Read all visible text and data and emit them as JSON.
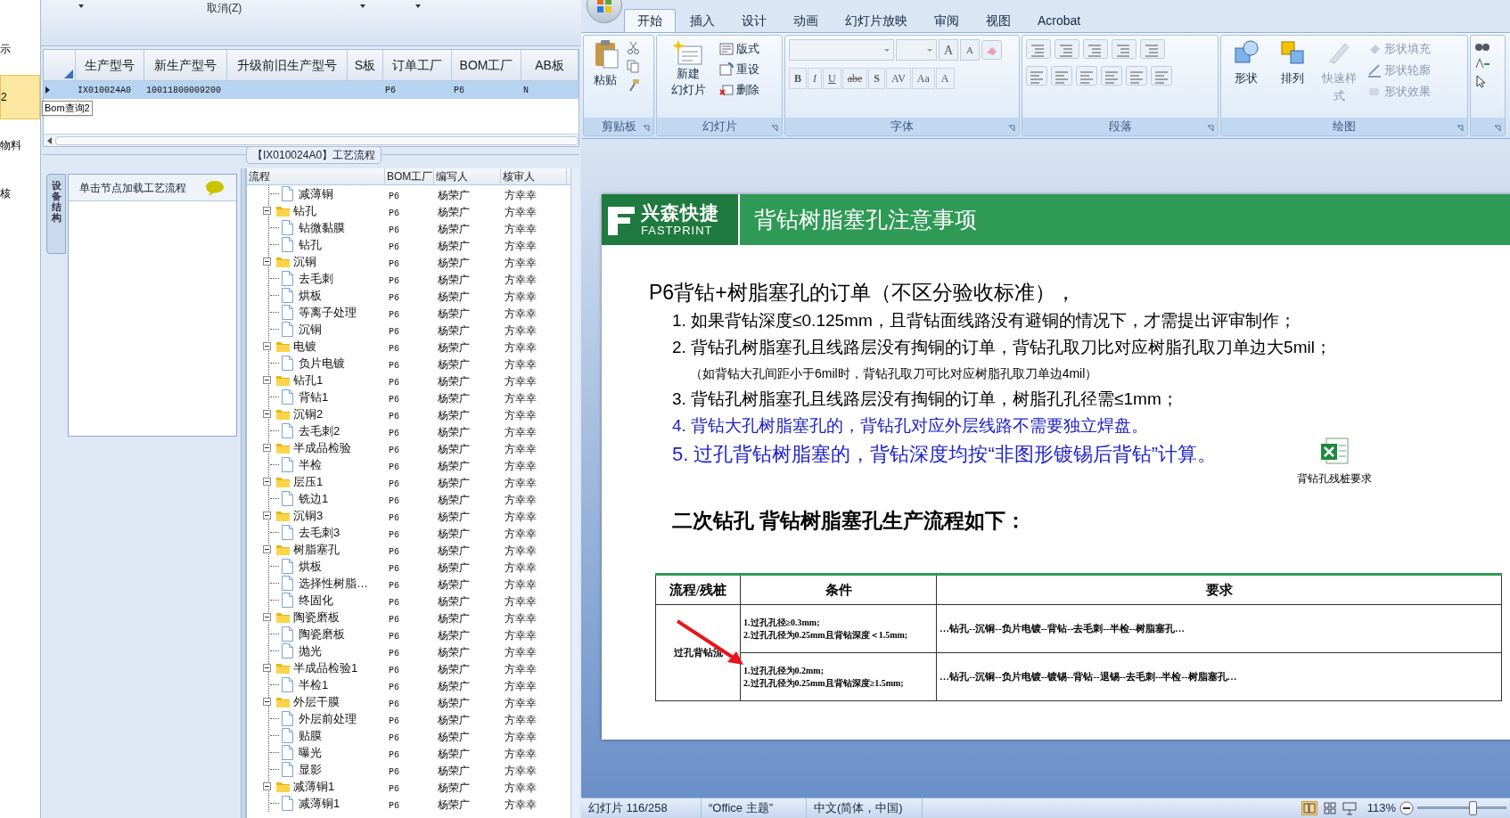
{
  "left_app": {
    "nav_items": [
      {
        "label": "示",
        "selected": false
      },
      {
        "label": "2",
        "selected": true
      },
      {
        "label": "物料",
        "selected": false
      },
      {
        "label": "核",
        "selected": false
      }
    ],
    "toolbar": {
      "cancel_button": "取消(Z)"
    },
    "grid": {
      "columns": [
        "生产型号",
        "新生产型号",
        "升级前旧生产型号",
        "S板",
        "订单工厂",
        "BOM工厂",
        "AB板"
      ],
      "rows": [
        {
          "cells": [
            "IX010024A0",
            "10011800009200",
            "",
            "",
            "P6",
            "P6",
            "N"
          ],
          "selected": true
        }
      ]
    },
    "tooltip": "Bom查询2",
    "flow_group_title": "【IX010024A0】工艺流程",
    "side_tab": "设备结构",
    "side_panel_header": "单击节点加载工艺流程",
    "tree": {
      "columns": [
        "流程",
        "BOM工厂",
        "编写人",
        "核审人"
      ],
      "nodes": [
        {
          "children": [
            {
              "label": "减薄铜",
              "kind": "file",
              "bom": "P6",
              "author": "杨荣广",
              "reviewer": "方幸幸"
            }
          ]
        },
        {
          "label": "钻孔",
          "kind": "folder",
          "expanded": true,
          "bom": "P6",
          "author": "杨荣广",
          "reviewer": "方幸幸",
          "children": [
            {
              "label": "钻微黏膜",
              "kind": "file",
              "bom": "P6",
              "author": "杨荣广",
              "reviewer": "方幸幸"
            },
            {
              "label": "钻孔",
              "kind": "file",
              "bom": "P6",
              "author": "杨荣广",
              "reviewer": "方幸幸"
            }
          ]
        },
        {
          "label": "沉铜",
          "kind": "folder",
          "expanded": true,
          "bom": "P6",
          "author": "杨荣广",
          "reviewer": "方幸幸",
          "children": [
            {
              "label": "去毛刺",
              "kind": "file",
              "bom": "P6",
              "author": "杨荣广",
              "reviewer": "方幸幸"
            },
            {
              "label": "烘板",
              "kind": "file",
              "bom": "P6",
              "author": "杨荣广",
              "reviewer": "方幸幸"
            },
            {
              "label": "等离子处理",
              "kind": "file",
              "bom": "P6",
              "author": "杨荣广",
              "reviewer": "方幸幸"
            },
            {
              "label": "沉铜",
              "kind": "file",
              "bom": "P6",
              "author": "杨荣广",
              "reviewer": "方幸幸"
            }
          ]
        },
        {
          "label": "电镀",
          "kind": "folder",
          "expanded": true,
          "bom": "P6",
          "author": "杨荣广",
          "reviewer": "方幸幸",
          "children": [
            {
              "label": "负片电镀",
              "kind": "file",
              "bom": "P6",
              "author": "杨荣广",
              "reviewer": "方幸幸"
            }
          ]
        },
        {
          "label": "钻孔1",
          "kind": "folder",
          "expanded": true,
          "bom": "P6",
          "author": "杨荣广",
          "reviewer": "方幸幸",
          "children": [
            {
              "label": "背钻1",
              "kind": "file",
              "bom": "P6",
              "author": "杨荣广",
              "reviewer": "方幸幸"
            }
          ]
        },
        {
          "label": "沉铜2",
          "kind": "folder",
          "expanded": true,
          "bom": "P6",
          "author": "杨荣广",
          "reviewer": "方幸幸",
          "children": [
            {
              "label": "去毛刺2",
              "kind": "file",
              "bom": "P6",
              "author": "杨荣广",
              "reviewer": "方幸幸"
            }
          ]
        },
        {
          "label": "半成品检验",
          "kind": "folder",
          "expanded": true,
          "bom": "P6",
          "author": "杨荣广",
          "reviewer": "方幸幸",
          "children": [
            {
              "label": "半检",
              "kind": "file",
              "bom": "P6",
              "author": "杨荣广",
              "reviewer": "方幸幸"
            }
          ]
        },
        {
          "label": "层压1",
          "kind": "folder",
          "expanded": true,
          "bom": "P6",
          "author": "杨荣广",
          "reviewer": "方幸幸",
          "children": [
            {
              "label": "铣边1",
              "kind": "file",
              "bom": "P6",
              "author": "杨荣广",
              "reviewer": "方幸幸"
            }
          ]
        },
        {
          "label": "沉铜3",
          "kind": "folder",
          "expanded": true,
          "bom": "P6",
          "author": "杨荣广",
          "reviewer": "方幸幸",
          "children": [
            {
              "label": "去毛刺3",
              "kind": "file",
              "bom": "P6",
              "author": "杨荣广",
              "reviewer": "方幸幸"
            }
          ]
        },
        {
          "label": "树脂塞孔",
          "kind": "folder",
          "expanded": true,
          "bom": "P6",
          "author": "杨荣广",
          "reviewer": "方幸幸",
          "children": [
            {
              "label": "烘板",
              "kind": "file",
              "bom": "P6",
              "author": "杨荣广",
              "reviewer": "方幸幸"
            },
            {
              "label": "选择性树脂…",
              "kind": "file",
              "bom": "P6",
              "author": "杨荣广",
              "reviewer": "方幸幸"
            },
            {
              "label": "终固化",
              "kind": "file",
              "bom": "P6",
              "author": "杨荣广",
              "reviewer": "方幸幸"
            }
          ]
        },
        {
          "label": "陶瓷磨板",
          "kind": "folder",
          "expanded": true,
          "bom": "P6",
          "author": "杨荣广",
          "reviewer": "方幸幸",
          "children": [
            {
              "label": "陶瓷磨板",
              "kind": "file",
              "bom": "P6",
              "author": "杨荣广",
              "reviewer": "方幸幸"
            },
            {
              "label": "抛光",
              "kind": "file",
              "bom": "P6",
              "author": "杨荣广",
              "reviewer": "方幸幸"
            }
          ]
        },
        {
          "label": "半成品检验1",
          "kind": "folder",
          "expanded": true,
          "bom": "P6",
          "author": "杨荣广",
          "reviewer": "方幸幸",
          "children": [
            {
              "label": "半检1",
              "kind": "file",
              "bom": "P6",
              "author": "杨荣广",
              "reviewer": "方幸幸"
            }
          ]
        },
        {
          "label": "外层干膜",
          "kind": "folder",
          "expanded": true,
          "bom": "P6",
          "author": "杨荣广",
          "reviewer": "方幸幸",
          "children": [
            {
              "label": "外层前处理",
              "kind": "file",
              "bom": "P6",
              "author": "杨荣广",
              "reviewer": "方幸幸"
            },
            {
              "label": "贴膜",
              "kind": "file",
              "bom": "P6",
              "author": "杨荣广",
              "reviewer": "方幸幸"
            },
            {
              "label": "曝光",
              "kind": "file",
              "bom": "P6",
              "author": "杨荣广",
              "reviewer": "方幸幸"
            },
            {
              "label": "显影",
              "kind": "file",
              "bom": "P6",
              "author": "杨荣广",
              "reviewer": "方幸幸"
            }
          ]
        },
        {
          "label": "减薄铜1",
          "kind": "folder",
          "expanded": true,
          "bom": "P6",
          "author": "杨荣广",
          "reviewer": "方幸幸",
          "children": [
            {
              "label": "减薄铜1",
              "kind": "file",
              "bom": "P6",
              "author": "杨荣广",
              "reviewer": "方幸幸"
            }
          ]
        }
      ]
    }
  },
  "ppt": {
    "tabs": [
      {
        "label": "开始",
        "selected": true
      },
      {
        "label": "插入",
        "selected": false
      },
      {
        "label": "设计",
        "selected": false
      },
      {
        "label": "动画",
        "selected": false
      },
      {
        "label": "幻灯片放映",
        "selected": false
      },
      {
        "label": "审阅",
        "selected": false
      },
      {
        "label": "视图",
        "selected": false
      },
      {
        "label": "Acrobat",
        "selected": false
      }
    ],
    "ribbon": {
      "clipboard": {
        "label": "剪贴板",
        "paste": "粘贴"
      },
      "slides": {
        "label": "幻灯片",
        "new_slide": [
          "新建",
          "幻灯片"
        ],
        "layout": "版式",
        "reset": "重设",
        "delete": "删除"
      },
      "font": {
        "label": "字体",
        "size_buttons": [
          "A",
          "A"
        ],
        "format_buttons": [
          "B",
          "I",
          "U",
          "abe",
          "S",
          "AV",
          "Aa",
          "A"
        ]
      },
      "paragraph": {
        "label": "段落"
      },
      "drawing": {
        "label": "绘图",
        "shapes": "形状",
        "arrange": "排列",
        "quick_styles": "快速样式",
        "fill": "形状填充",
        "outline": "形状轮廓",
        "effects": "形状效果"
      }
    },
    "slide": {
      "logo": {
        "cn": "兴森快捷",
        "en": "FASTPRINT"
      },
      "title": "背钻树脂塞孔注意事项",
      "lead": "P6背钻+树脂塞孔的订单（不区分验收标准），",
      "items": [
        {
          "kind": "item",
          "number": "1.",
          "text": "如果背钻深度≤0.125mm，且背钻面线路没有避铜的情况下，才需提出评审制作；",
          "color": "#000000"
        },
        {
          "kind": "item",
          "number": "2.",
          "text": "背钻孔树脂塞孔且线路层没有掏铜的订单，背钻孔取刀比对应树脂孔取刀单边大5mil；",
          "color": "#000000"
        },
        {
          "kind": "note",
          "text": "（如背钻大孔间距小于6mil时，背钻孔取刀可比对应树脂孔取刀单边4mil）",
          "color": "#000000"
        },
        {
          "kind": "item",
          "number": "3.",
          "text": "背钻孔树脂塞孔且线路层没有掏铜的订单，树脂孔孔径需≤1mm；",
          "color": "#000000"
        },
        {
          "kind": "item",
          "number": "4.",
          "text": "背钻大孔树脂塞孔的，背钻孔对应外层线路不需要独立焊盘。",
          "color": "#2020c8"
        },
        {
          "kind": "large",
          "number": "5.",
          "text": "过孔背钻树脂塞的，背钻深度均按“非图形镀锡后背钻”计算。",
          "color": "#2020c8"
        }
      ],
      "attachment": "背钻孔残桩要求",
      "subheading": "二次钻孔 背钻树脂塞孔生产流程如下：",
      "table": {
        "columns": [
          "流程/残桩",
          "条件",
          "要求"
        ],
        "row_label": "过孔背钻流",
        "rows": [
          {
            "conditions": [
              "1.过孔孔径≥0.3mm;",
              "2.过孔孔径为0.25mm且背钻深度＜1.5mm;"
            ],
            "requirement": "…钻孔--沉铜--负片电镀--背钻--去毛刺--半检--树脂塞孔…"
          },
          {
            "conditions": [
              "1.过孔孔径为0.2mm;",
              "2.过孔孔径为0.25mm且背钻深度≥1.5mm;"
            ],
            "requirement": "…钻孔--沉铜--负片电镀--镀锡--背钻--退锡--去毛刺--半检--树脂塞孔…"
          }
        ]
      }
    },
    "status_bar": {
      "slide_count": "幻灯片 116/258",
      "theme": "“Office 主题”",
      "language": "中文(简体，中国)",
      "zoom": "113%",
      "level": 0.62
    }
  }
}
